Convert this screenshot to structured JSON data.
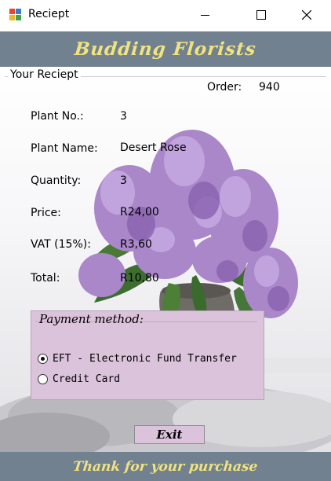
{
  "window": {
    "title": "Reciept",
    "icon": "windows-forms-app-icon",
    "controls": [
      "minimize-icon",
      "maximize-icon",
      "close-icon"
    ]
  },
  "header": {
    "title": "Budding Florists"
  },
  "receipt": {
    "group_label": "Your Reciept",
    "order_label": "Order:",
    "order_value": "940",
    "fields": [
      {
        "label": "Plant No.:",
        "value": "3"
      },
      {
        "label": "Plant Name:",
        "value": "Desert Rose"
      },
      {
        "label": "Quantity:",
        "value": "3"
      },
      {
        "label": "Price:",
        "value": "R24,00"
      },
      {
        "label": "VAT (15%):",
        "value": "R3,60"
      },
      {
        "label": "Total:",
        "value": "R10,80"
      }
    ]
  },
  "payment": {
    "legend": "Payment method:",
    "options": [
      {
        "label": "EFT - Electronic Fund Transfer",
        "selected": true
      },
      {
        "label": "Credit Card",
        "selected": false
      }
    ]
  },
  "exit_label": "Exit",
  "footer": {
    "text": "Thank for your purchase"
  },
  "colors": {
    "banner": "#71818f",
    "banner_text": "#f1e37e",
    "panel": "#dcc3dc",
    "flowers": "#a987c9",
    "leaves": "#3d6d2f"
  }
}
